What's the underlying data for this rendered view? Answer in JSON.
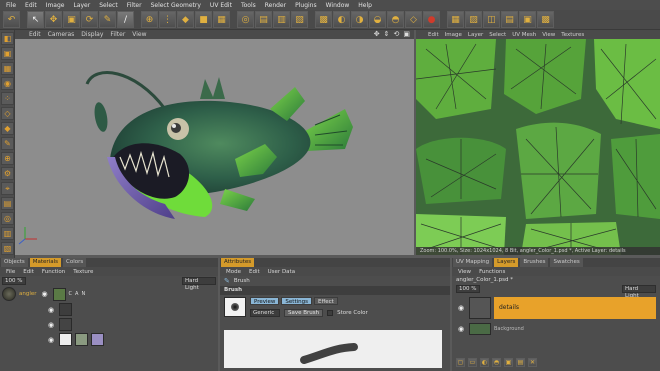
{
  "menubar": [
    "File",
    "Edit",
    "Image",
    "Layer",
    "Select",
    "Filter",
    "Select Geometry",
    "UV Edit",
    "Tools",
    "Render",
    "Plugins",
    "Window",
    "Help"
  ],
  "viewport": {
    "menu": [
      "Edit",
      "Cameras",
      "Display",
      "Filter",
      "View"
    ]
  },
  "uv_editor": {
    "menu": [
      "Edit",
      "Image",
      "Layer",
      "Select",
      "UV Mesh",
      "View",
      "Textures"
    ],
    "status": "Zoom: 100.0%, Size: 1024x1024, 8 Bit, angler_Color_1.psd *, Active Layer: details"
  },
  "objects_panel": {
    "tabs": [
      "Objects",
      "Materials",
      "Colors"
    ],
    "menu": [
      "File",
      "Edit",
      "Function",
      "Texture"
    ],
    "percent": "100 %",
    "blend": "Hard Light",
    "material_name": "angler",
    "channel_labels": [
      "C",
      "A",
      "N"
    ]
  },
  "attributes_panel": {
    "tabs": [
      "Attributes"
    ],
    "menu": [
      "Mode",
      "Edit",
      "User Data"
    ],
    "tool_name": "Brush",
    "section": "Brush",
    "subtabs": [
      "Preview",
      "Settings",
      "Effect"
    ],
    "preset": "Generic",
    "save_button": "Save Brush",
    "store_color": "Store Color"
  },
  "layers_panel": {
    "tabs": [
      "UV Mapping",
      "Layers",
      "Brushes",
      "Swatches"
    ],
    "menu": [
      "View",
      "Functions"
    ],
    "file_name": "angler_Color_1.psd *",
    "percent": "100 %",
    "blend": "Hard Light",
    "layers": [
      "details",
      "Background"
    ]
  },
  "colors": {
    "accent": "#d49a2a",
    "panel": "#4d4d4d",
    "viewport": "#8d8d8d",
    "uv_bg": "#3b5e36"
  }
}
